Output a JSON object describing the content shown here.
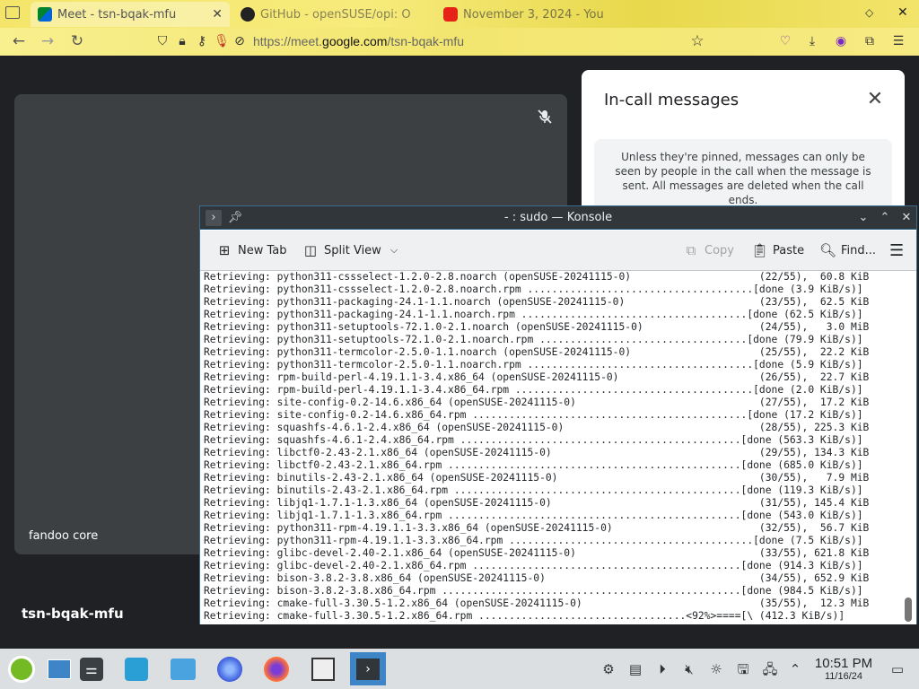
{
  "browser": {
    "tabs": [
      {
        "title": "Meet - tsn-bqak-mfu",
        "active": true
      },
      {
        "title": "GitHub - openSUSE/opi: O",
        "active": false
      },
      {
        "title": "November 3, 2024 - You",
        "active": false
      }
    ],
    "url_prefix": "https://meet.",
    "url_domain": "google.com",
    "url_path": "/tsn-bqak-mfu"
  },
  "meet": {
    "participant_name": "fandoo core",
    "meeting_code": "tsn-bqak-mfu",
    "panel_title": "In-call messages",
    "panel_note": "Unless they're pinned, messages can only be seen by people in the call when the message is sent. All messages are deleted when the call ends."
  },
  "konsole": {
    "title": "- : sudo — Konsole",
    "toolbar": {
      "new_tab": "New Tab",
      "split_view": "Split View",
      "copy": "Copy",
      "paste": "Paste",
      "find": "Find..."
    },
    "lines": [
      "Retrieving: python311-cssselect-1.2.0-2.8.noarch (openSUSE-20241115-0)                     (22/55),  60.8 KiB",
      "Retrieving: python311-cssselect-1.2.0-2.8.noarch.rpm .....................................[done (3.9 KiB/s)]",
      "Retrieving: python311-packaging-24.1-1.1.noarch (openSUSE-20241115-0)                      (23/55),  62.5 KiB",
      "Retrieving: python311-packaging-24.1-1.1.noarch.rpm .....................................[done (62.5 KiB/s)]",
      "Retrieving: python311-setuptools-72.1.0-2.1.noarch (openSUSE-20241115-0)                   (24/55),   3.0 MiB",
      "Retrieving: python311-setuptools-72.1.0-2.1.noarch.rpm ..................................[done (79.9 KiB/s)]",
      "Retrieving: python311-termcolor-2.5.0-1.1.noarch (openSUSE-20241115-0)                     (25/55),  22.2 KiB",
      "Retrieving: python311-termcolor-2.5.0-1.1.noarch.rpm .....................................[done (5.9 KiB/s)]",
      "Retrieving: rpm-build-perl-4.19.1.1-3.4.x86_64 (openSUSE-20241115-0)                       (26/55),  22.7 KiB",
      "Retrieving: rpm-build-perl-4.19.1.1-3.4.x86_64.rpm .......................................[done (2.0 KiB/s)]",
      "Retrieving: site-config-0.2-14.6.x86_64 (openSUSE-20241115-0)                              (27/55),  17.2 KiB",
      "Retrieving: site-config-0.2-14.6.x86_64.rpm .............................................[done (17.2 KiB/s)]",
      "Retrieving: squashfs-4.6.1-2.4.x86_64 (openSUSE-20241115-0)                                (28/55), 225.3 KiB",
      "Retrieving: squashfs-4.6.1-2.4.x86_64.rpm ..............................................[done (563.3 KiB/s)]",
      "Retrieving: libctf0-2.43-2.1.x86_64 (openSUSE-20241115-0)                                  (29/55), 134.3 KiB",
      "Retrieving: libctf0-2.43-2.1.x86_64.rpm ................................................[done (685.0 KiB/s)]",
      "Retrieving: binutils-2.43-2.1.x86_64 (openSUSE-20241115-0)                                 (30/55),   7.9 MiB",
      "Retrieving: binutils-2.43-2.1.x86_64.rpm ...............................................[done (119.3 KiB/s)]",
      "Retrieving: libjq1-1.7.1-1.3.x86_64 (openSUSE-20241115-0)                                  (31/55), 145.4 KiB",
      "Retrieving: libjq1-1.7.1-1.3.x86_64.rpm ................................................[done (543.0 KiB/s)]",
      "Retrieving: python311-rpm-4.19.1.1-3.3.x86_64 (openSUSE-20241115-0)                        (32/55),  56.7 KiB",
      "Retrieving: python311-rpm-4.19.1.1-3.3.x86_64.rpm ........................................[done (7.5 KiB/s)]",
      "Retrieving: glibc-devel-2.40-2.1.x86_64 (openSUSE-20241115-0)                              (33/55), 621.8 KiB",
      "Retrieving: glibc-devel-2.40-2.1.x86_64.rpm ............................................[done (914.3 KiB/s)]",
      "Retrieving: bison-3.8.2-3.8.x86_64 (openSUSE-20241115-0)                                   (34/55), 652.9 KiB",
      "Retrieving: bison-3.8.2-3.8.x86_64.rpm .................................................[done (984.5 KiB/s)]",
      "Retrieving: cmake-full-3.30.5-1.2.x86_64 (openSUSE-20241115-0)                             (35/55),  12.3 MiB",
      "Retrieving: cmake-full-3.30.5-1.2.x86_64.rpm ..................................<92%>====[\\ (412.3 KiB/s)]"
    ]
  },
  "taskbar": {
    "time": "10:51 PM",
    "date": "11/16/24"
  },
  "colors": {
    "meet_bg": "#202124",
    "konsole_titlebar": "#31363b",
    "taskbar": "#dcdfe2",
    "active_app": "#3d85c6"
  }
}
